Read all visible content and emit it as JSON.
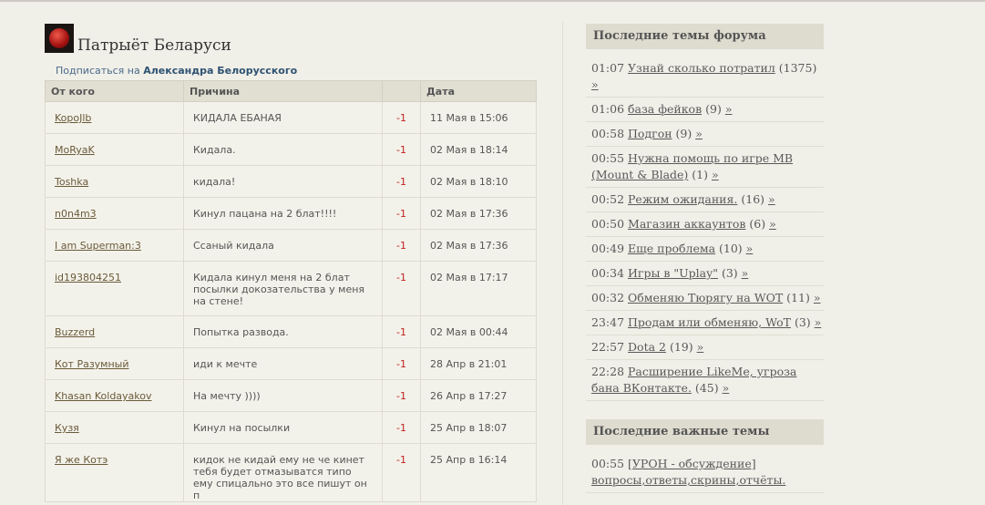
{
  "profile": {
    "title": "Патрыёт Беларуси",
    "subscribe_prefix": "Подписаться на",
    "subscribe_name": "Александра Белорусского"
  },
  "table": {
    "headers": [
      "От кого",
      "Причина",
      "",
      "Дата"
    ],
    "rows": [
      {
        "from": "KopoJlb",
        "reason": "КИДАЛА ЕБАНАЯ",
        "value": "-1",
        "date": "11 Мая в 15:06"
      },
      {
        "from": "MoRyaK",
        "reason": "Кидала.",
        "value": "-1",
        "date": "02 Мая в 18:14"
      },
      {
        "from": "Toshka",
        "reason": "кидала!",
        "value": "-1",
        "date": "02 Мая в 18:10"
      },
      {
        "from": "n0n4m3",
        "reason": "Кинул пацана на 2 блат!!!!",
        "value": "-1",
        "date": "02 Мая в 17:36"
      },
      {
        "from": "I am Superman:3",
        "reason": "Ссаный кидала",
        "value": "-1",
        "date": "02 Мая в 17:36"
      },
      {
        "from": "id193804251",
        "reason": "Кидала кинул меня на 2 блат посылки докозательства у меня на стене!",
        "value": "-1",
        "date": "02 Мая в 17:17"
      },
      {
        "from": "Buzzerd",
        "reason": "Попытка развода.",
        "value": "-1",
        "date": "02 Мая в 00:44"
      },
      {
        "from": "Кот Разумный",
        "reason": "иди к мечте",
        "value": "-1",
        "date": "28 Апр в 21:01"
      },
      {
        "from": "Khasan Koldayakov",
        "reason": "На мечту ))))",
        "value": "-1",
        "date": "26 Апр в 17:27"
      },
      {
        "from": "Кузя",
        "reason": "Кинул на посылки",
        "value": "-1",
        "date": "25 Апр в 18:07"
      },
      {
        "from": "Я же Котэ",
        "reason": "кидок не кидай ему не че кинет тебя будет отмазыватся типо ему спицально это все пишут он п",
        "value": "-1",
        "date": "25 Апр в 16:14"
      }
    ]
  },
  "sidebar": {
    "forum_title": "Последние темы форума",
    "forum_topics": [
      {
        "time": "01:07",
        "title": "Узнай сколько потратил",
        "count": "(1375)"
      },
      {
        "time": "01:06",
        "title": "база фейков",
        "count": "(9)"
      },
      {
        "time": "00:58",
        "title": "Подгон",
        "count": "(9)"
      },
      {
        "time": "00:55",
        "title": "Нужна помощь по игре MB (Mount & Blade)",
        "count": "(1)"
      },
      {
        "time": "00:52",
        "title": "Режим ожидания.",
        "count": "(16)"
      },
      {
        "time": "00:50",
        "title": "Магазин аккаунтов",
        "count": "(6)"
      },
      {
        "time": "00:49",
        "title": "Еще проблема",
        "count": "(10)"
      },
      {
        "time": "00:34",
        "title": "Игры в \"Uplay\"",
        "count": "(3)"
      },
      {
        "time": "00:32",
        "title": "Обменяю Тюрягу на WOT",
        "count": "(11)"
      },
      {
        "time": "23:47",
        "title": "Продам или обменяю, WoT",
        "count": "(3)"
      },
      {
        "time": "22:57",
        "title": "Dota 2",
        "count": "(19)"
      },
      {
        "time": "22:28",
        "title": "Расширение LikeMe, угроза бана ВКонтакте.",
        "count": "(45)"
      }
    ],
    "important_title": "Последние важные темы",
    "important_topics": [
      {
        "time": "00:55",
        "title": "[УРОН - обсуждение] вопросы,ответы,скрины,отчёты."
      }
    ],
    "arrow": "»"
  }
}
